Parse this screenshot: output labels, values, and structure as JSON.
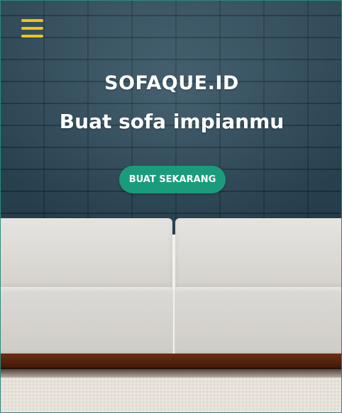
{
  "hero": {
    "brand": "SOFAQUE.ID",
    "tagline": "Buat sofa impianmu",
    "cta_label": "BUAT SEKARANG"
  },
  "nav": {
    "menu_icon": "hamburger-menu-icon"
  },
  "colors": {
    "accent_yellow": "#f2c412",
    "cta_green": "#1a9c7c",
    "wall_blue": "#2f4f61"
  }
}
